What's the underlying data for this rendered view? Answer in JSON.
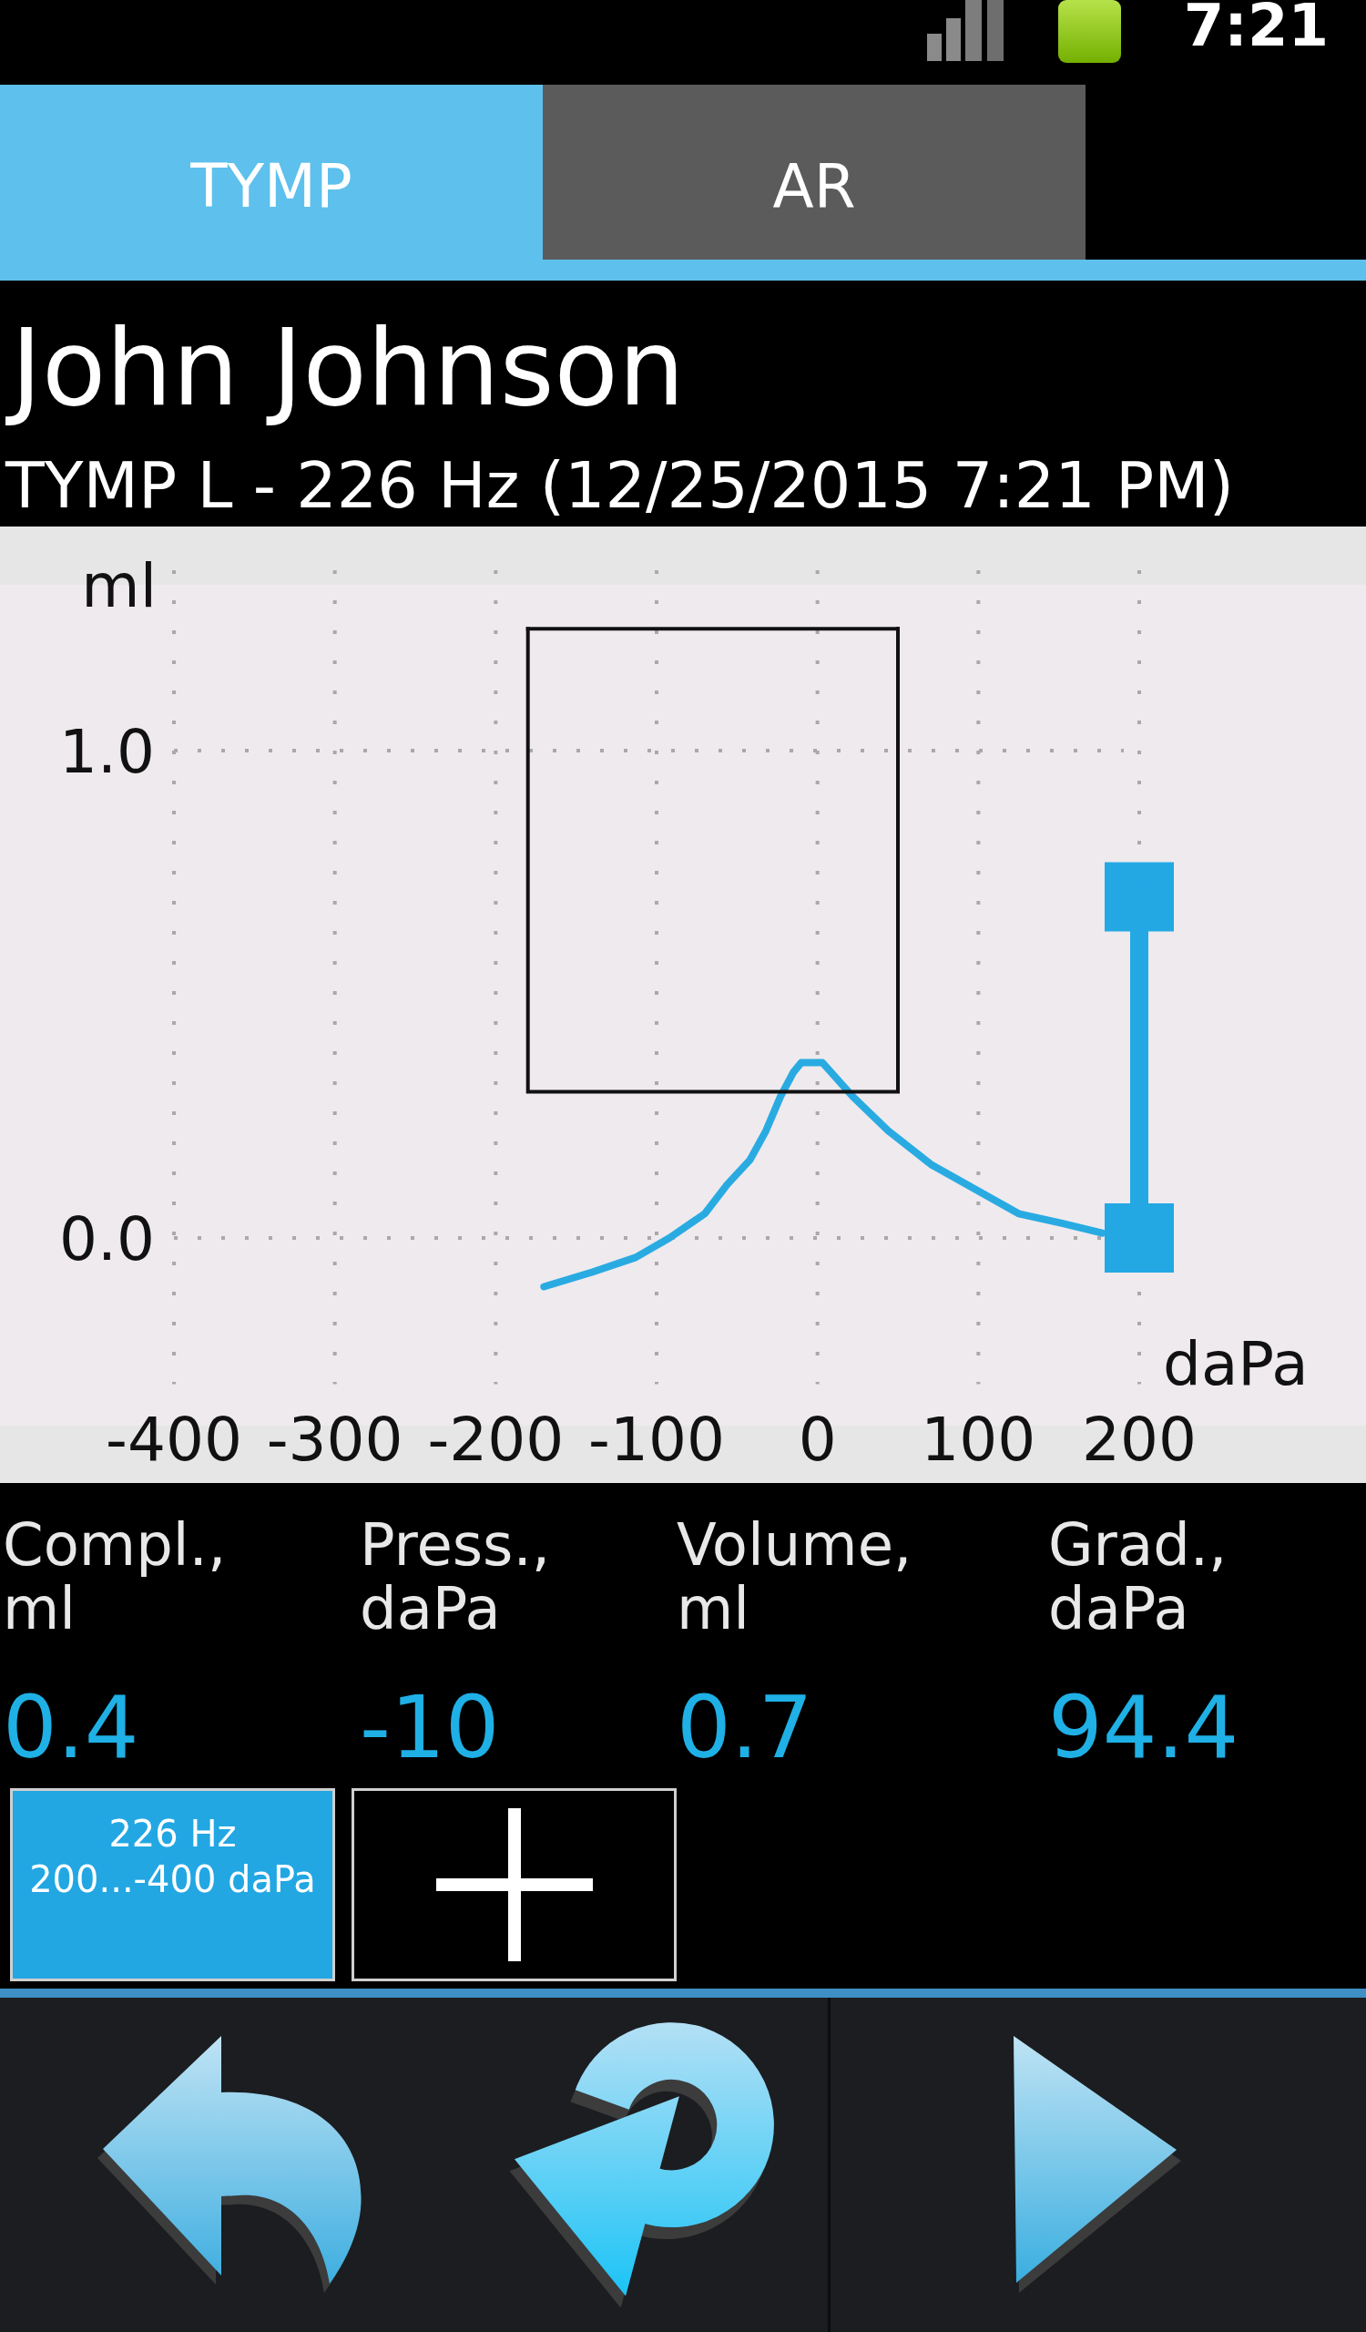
{
  "status_bar": {
    "time": "7:21"
  },
  "tabs": [
    {
      "label": "TYMP",
      "selected": true
    },
    {
      "label": "AR",
      "selected": false
    }
  ],
  "patient": {
    "name": "John Johnson",
    "test": "TYMP L - 226 Hz (12/25/2015 7:21 PM)"
  },
  "graph": {
    "chart_data": {
      "type": "line",
      "xlabel": "daPa",
      "ylabel": "ml",
      "x": [
        -170,
        -140,
        -113,
        -92,
        -70,
        -56,
        -42,
        -32,
        -23,
        -15,
        -10,
        3,
        22,
        44,
        71,
        98,
        125,
        152,
        177,
        -180,
        -180,
        50,
        50,
        -180,
        50,
        200,
        200
      ],
      "series": [
        {
          "color": "#29abe2",
          "values": [
            -0.1,
            -0.07,
            -0.04,
            0,
            0.05,
            0.11,
            0.16,
            0.22,
            0.29,
            0.34,
            0.36,
            0.36,
            0.29,
            0.22,
            0.15,
            0.1,
            0.05,
            0.03,
            0.01,
            null,
            null,
            null,
            null,
            null,
            null,
            null,
            null
          ]
        },
        {
          "color": "#111111",
          "values": [
            null,
            null,
            null,
            null,
            null,
            null,
            null,
            null,
            null,
            null,
            null,
            null,
            null,
            null,
            null,
            null,
            null,
            null,
            null,
            1.25,
            0.3,
            0.3,
            1.25,
            null,
            null,
            null,
            null
          ]
        },
        {
          "color": "#111111",
          "values": [
            null,
            null,
            null,
            null,
            null,
            null,
            null,
            null,
            null,
            null,
            null,
            null,
            null,
            null,
            null,
            null,
            null,
            null,
            null,
            null,
            null,
            null,
            null,
            1.25,
            1.25,
            null,
            null
          ]
        },
        {
          "color": "#23a8e4",
          "values": [
            null,
            null,
            null,
            null,
            null,
            null,
            null,
            null,
            null,
            null,
            null,
            null,
            null,
            null,
            null,
            null,
            null,
            null,
            null,
            null,
            null,
            null,
            null,
            null,
            null,
            0,
            0.7
          ]
        }
      ],
      "xlim": [
        -400,
        200
      ],
      "ylim": [
        -0.3,
        1.37
      ],
      "xticks": [
        -400,
        -300,
        -200,
        -100,
        0,
        100,
        200
      ],
      "yticks": [
        {
          "value": 0,
          "label": "0.0"
        },
        {
          "value": 1,
          "label": "1.0"
        }
      ],
      "grid": true
    }
  },
  "metrics": [
    {
      "name": "Compl.,",
      "unit": "ml",
      "value": "0.4"
    },
    {
      "name": "Press.,",
      "unit": "daPa",
      "value": "-10"
    },
    {
      "name": "Volume,",
      "unit": "ml",
      "value": "0.7"
    },
    {
      "name": "Grad.,",
      "unit": "daPa",
      "value": "94.4"
    }
  ],
  "scan_buttons": [
    {
      "kind": "scan",
      "frequency": "226 Hz",
      "range": "200...-400 daPa",
      "selected": true
    },
    {
      "kind": "add",
      "selected": false
    }
  ],
  "nav_buttons": [
    {
      "kind": "back"
    },
    {
      "kind": "refresh"
    },
    {
      "kind": "next"
    }
  ]
}
